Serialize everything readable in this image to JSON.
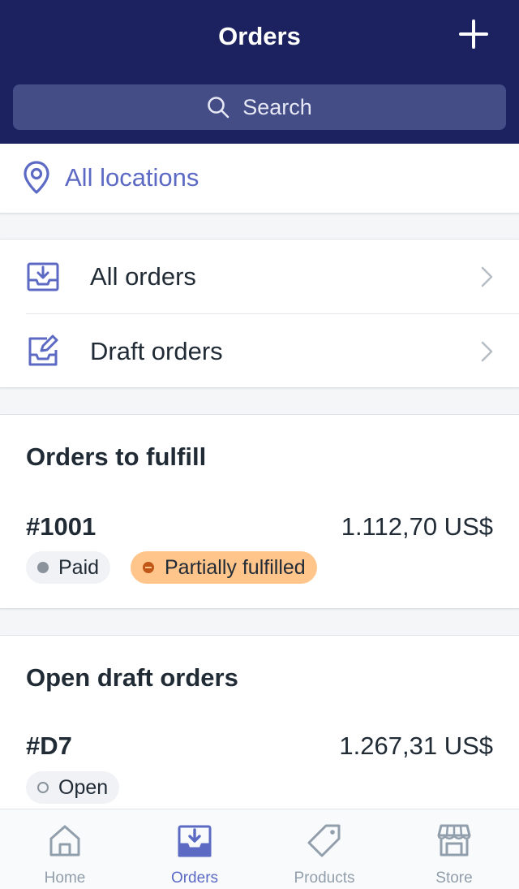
{
  "header": {
    "title": "Orders",
    "add_icon": "plus-icon"
  },
  "search": {
    "placeholder": "Search",
    "icon": "search-icon"
  },
  "location": {
    "label": "All locations",
    "icon": "location-pin-icon"
  },
  "nav": [
    {
      "label": "All orders",
      "icon": "inbox-download-icon"
    },
    {
      "label": "Draft orders",
      "icon": "draft-edit-icon"
    }
  ],
  "orders_to_fulfill": {
    "title": "Orders to fulfill",
    "order": {
      "number": "#1001",
      "amount": "1.112,70 US$",
      "payment_badge": "Paid",
      "fulfillment_badge": "Partially fulfilled"
    }
  },
  "open_drafts": {
    "title": "Open draft orders",
    "order": {
      "number": "#D7",
      "amount": "1.267,31 US$",
      "status_badge": "Open"
    }
  },
  "tabs": [
    {
      "label": "Home",
      "icon": "home-icon",
      "active": false
    },
    {
      "label": "Orders",
      "icon": "orders-icon",
      "active": true
    },
    {
      "label": "Products",
      "icon": "tag-icon",
      "active": false
    },
    {
      "label": "Store",
      "icon": "store-icon",
      "active": false
    }
  ],
  "colors": {
    "header_bg": "#1c2260",
    "accent": "#5c6ac4",
    "paid_badge_bg": "#f0f2f5",
    "partial_badge_bg": "#ffc58b",
    "partial_dot": "#c05717"
  }
}
